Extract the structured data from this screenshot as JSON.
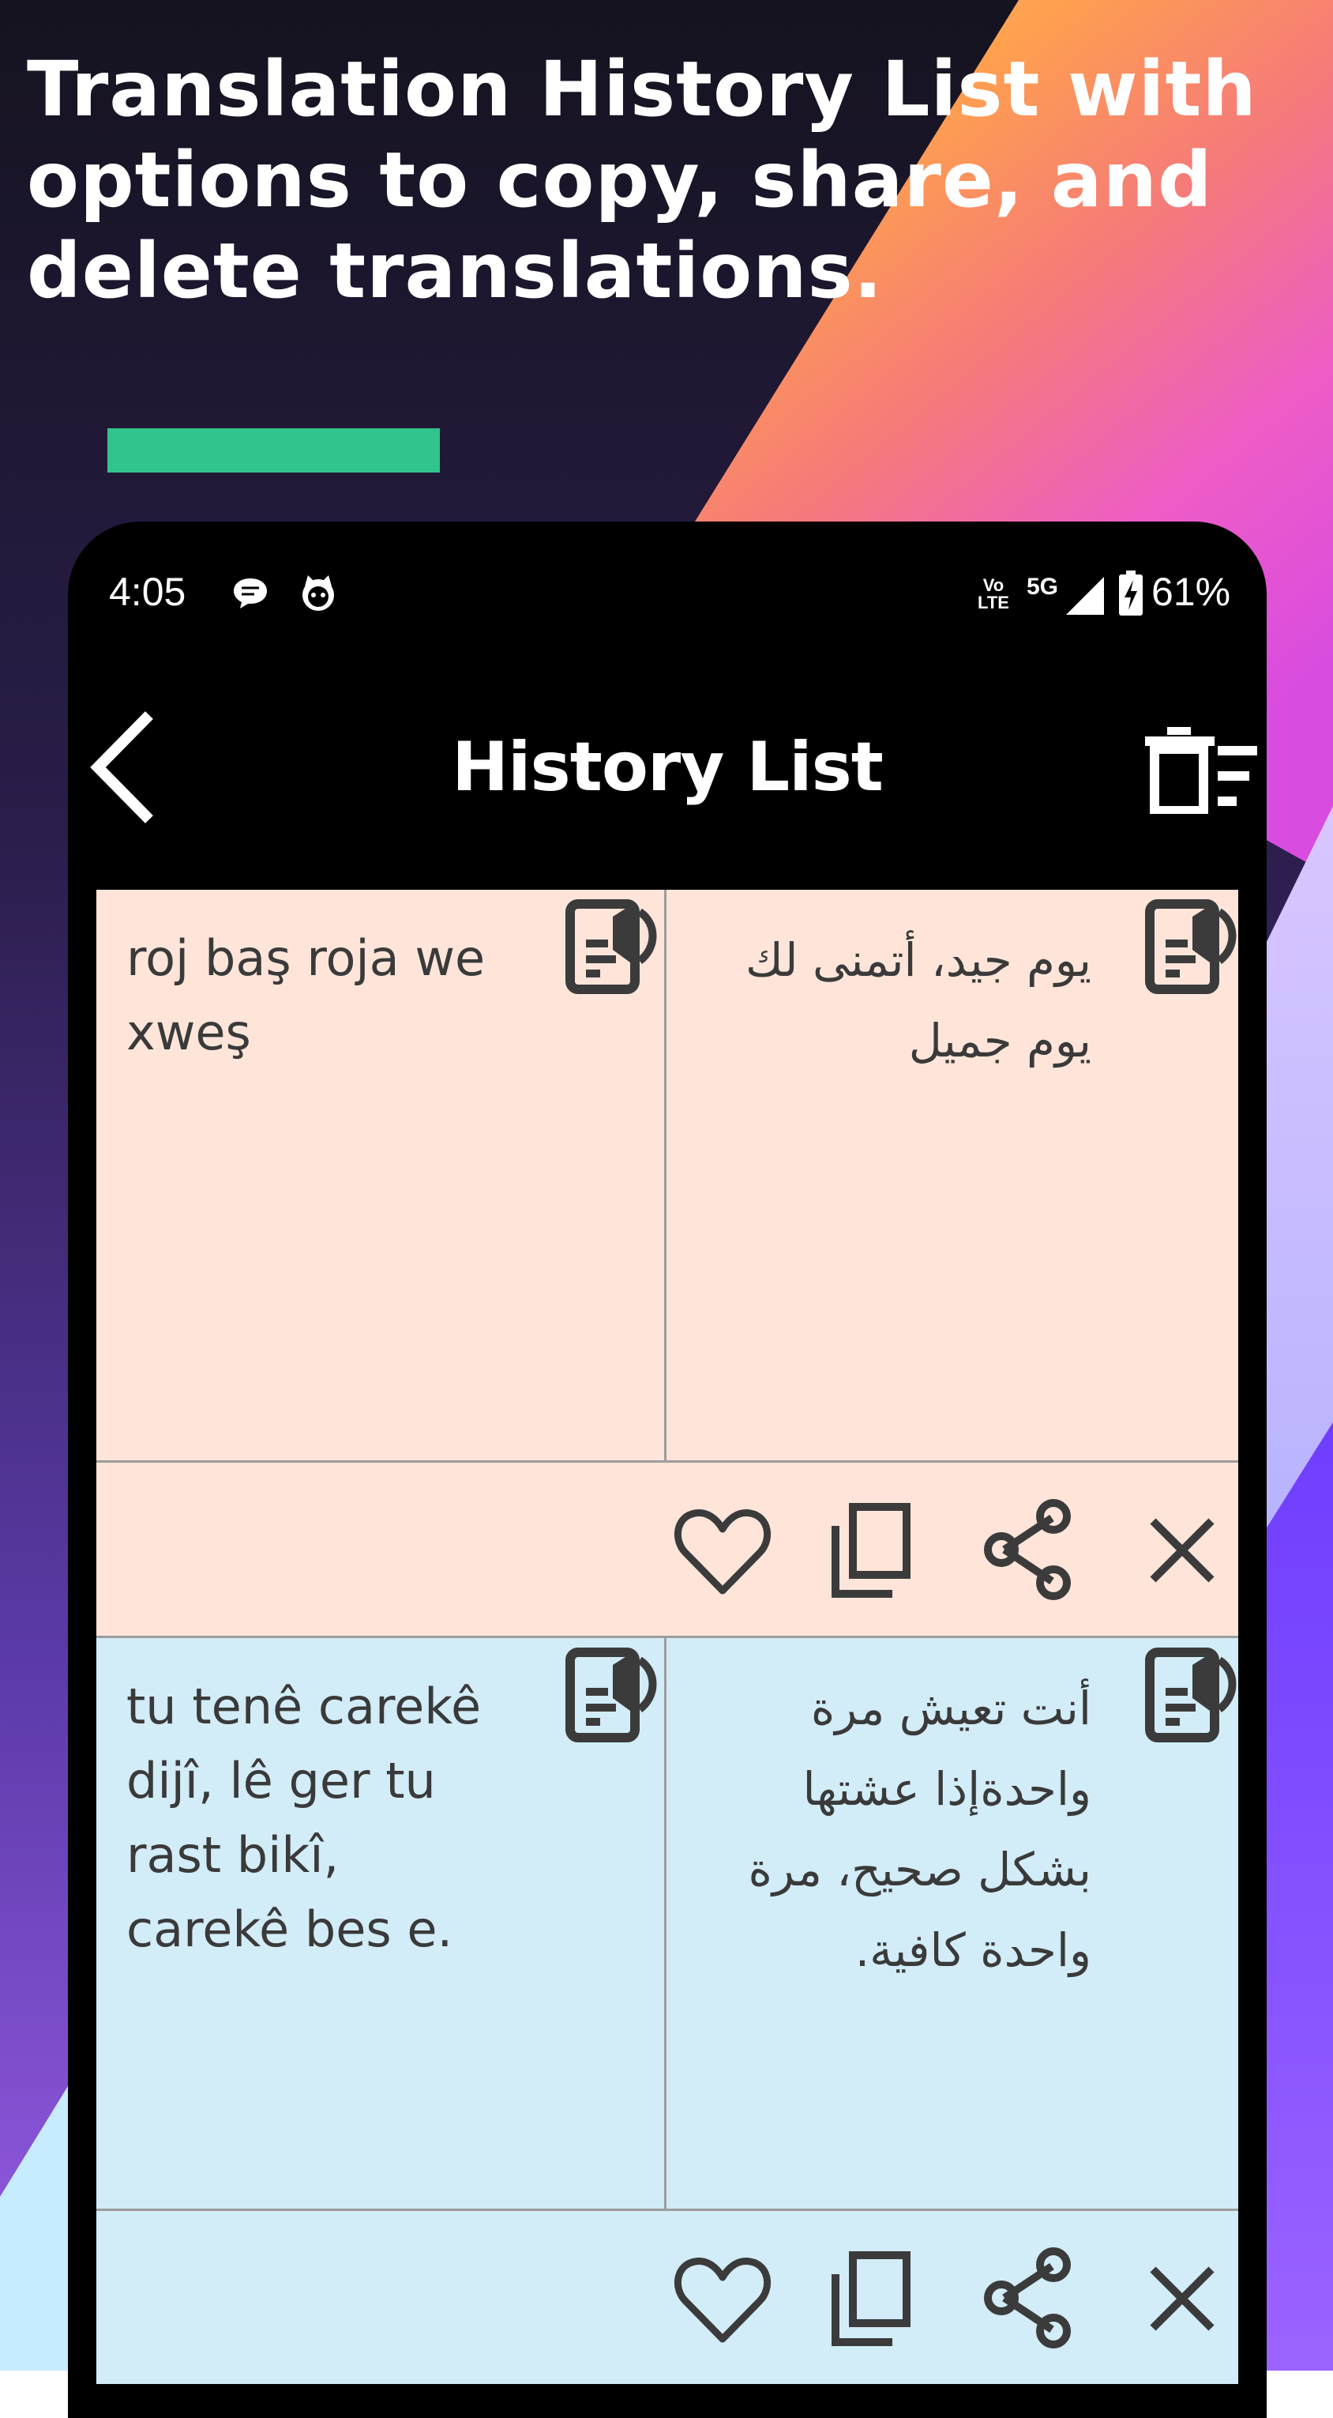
{
  "promo": {
    "headline_lines": [
      "Translation History List with",
      "options to copy, share, and",
      "delete translations."
    ]
  },
  "status_bar": {
    "time": "4:05",
    "volte": "Vo LTE",
    "network": "5G",
    "battery_pct": "61%"
  },
  "app_bar": {
    "title": "History List",
    "back_icon": "arrow-back-icon",
    "clear_icon": "delete-sweep-icon"
  },
  "history": [
    {
      "source": "roj baş roja we xweş",
      "translation": "يوم جيد، أتمنى لك يوم جميل",
      "bg": "#ffe5d9"
    },
    {
      "source": "tu tenê carekê dijî, lê ger tu rast bikî, carekê bes e.",
      "translation": "أنت تعيش مرة واحدةإذا عشتها بشكل صحيح، مرة واحدة كافية.",
      "bg": "#d2ecf8"
    }
  ],
  "colors": {
    "accent": "#31c48d",
    "icon": "#3b3b3b",
    "divider": "#9c9c9c"
  }
}
